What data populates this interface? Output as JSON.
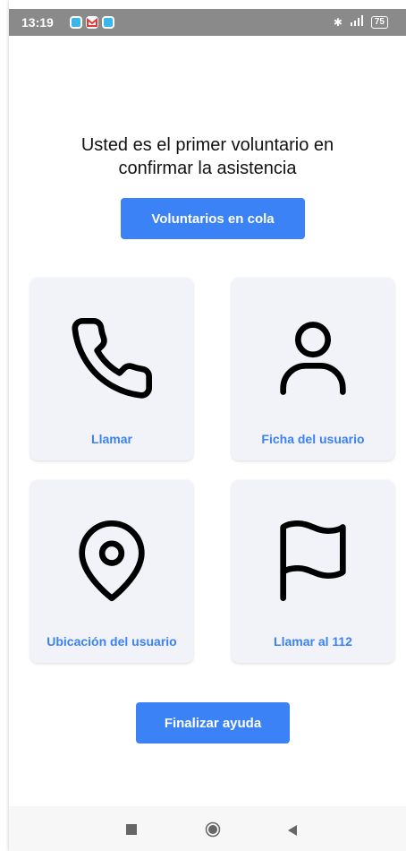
{
  "status_bar": {
    "time": "13:19",
    "battery": "75",
    "notification_icons": [
      "app-icon",
      "gmail-icon",
      "app-icon"
    ],
    "right_icons": [
      "bluetooth-icon",
      "signal-icon",
      "battery-icon"
    ]
  },
  "main": {
    "heading_line1": "Usted es el primer voluntario en",
    "heading_line2": "confirmar la asistencia",
    "queue_button": "Voluntarios en cola",
    "cards": [
      {
        "label": "Llamar",
        "icon": "phone-icon"
      },
      {
        "label": "Ficha del usuario",
        "icon": "user-icon"
      },
      {
        "label": "Ubicación del usuario",
        "icon": "location-pin-icon"
      },
      {
        "label": "Llamar al 112",
        "icon": "flag-icon"
      }
    ],
    "finish_button": "Finalizar ayuda"
  },
  "nav_bar": {
    "buttons": [
      "recents-square-icon",
      "home-circle-icon",
      "back-triangle-icon"
    ]
  },
  "colors": {
    "accent": "#3b82f6",
    "card_background": "#f1f3f8",
    "status_bar": "#8a8a8a"
  }
}
